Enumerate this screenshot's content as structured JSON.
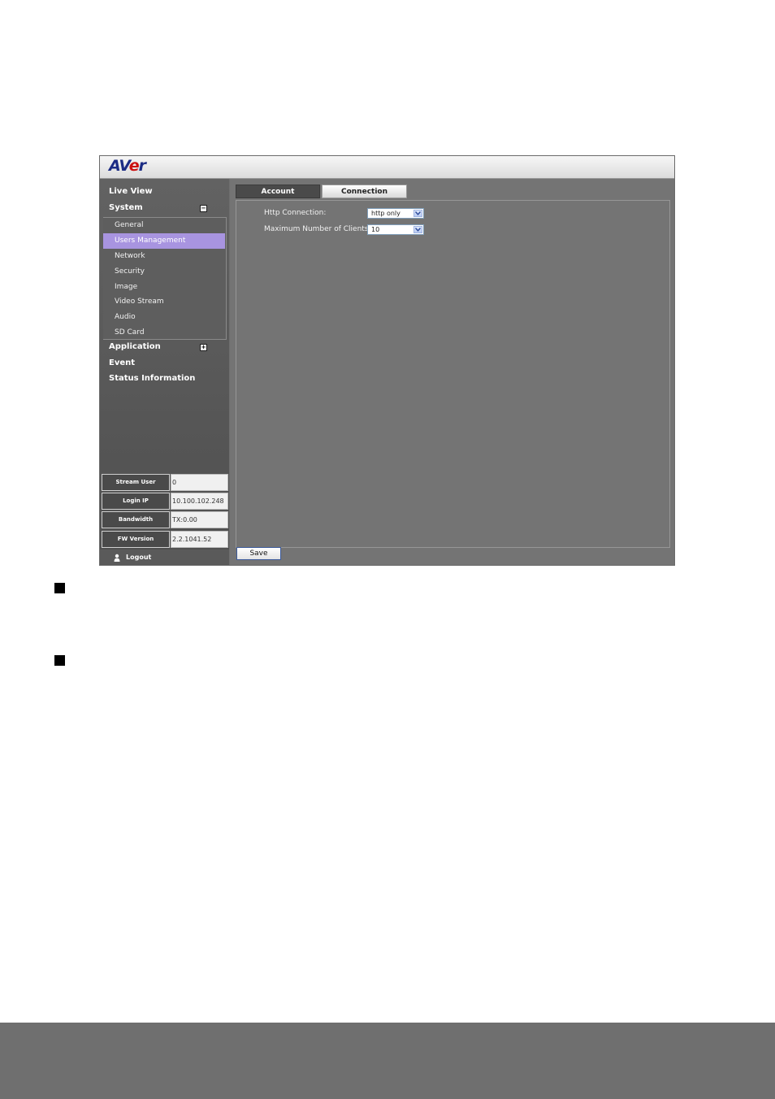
{
  "app": {
    "logo": {
      "part1": "AV",
      "part2": "e",
      "part3": "r"
    }
  },
  "sidebar": {
    "top_items": [
      {
        "label": "Live View"
      },
      {
        "label": "System",
        "toggle": "−"
      },
      {
        "label": "Application",
        "toggle": "+"
      },
      {
        "label": "Event"
      },
      {
        "label": "Status Information"
      }
    ],
    "system_items": [
      {
        "label": "General",
        "active": false
      },
      {
        "label": "Users Management",
        "active": true
      },
      {
        "label": "Network",
        "active": false
      },
      {
        "label": "Security",
        "active": false
      },
      {
        "label": "Image",
        "active": false
      },
      {
        "label": "Video Stream",
        "active": false
      },
      {
        "label": "Audio",
        "active": false
      },
      {
        "label": "SD Card",
        "active": false
      }
    ],
    "info": [
      {
        "label": "Stream User",
        "value": "0"
      },
      {
        "label": "Login IP",
        "value": "10.100.102.248"
      },
      {
        "label": "Bandwidth",
        "value": "TX:0.00"
      },
      {
        "label": "FW Version",
        "value": "2.2.1041.52"
      }
    ],
    "logout_label": "Logout",
    "logout_icon": "user-icon"
  },
  "main": {
    "tabs": [
      {
        "label": "Account",
        "selected": false
      },
      {
        "label": "Connection",
        "selected": true
      }
    ],
    "fields": [
      {
        "label": "Http Connection:",
        "value": "http only"
      },
      {
        "label": "Maximum Number of Clients:",
        "value": "10"
      }
    ],
    "save_label": "Save"
  },
  "colors": {
    "active_menu": "#a894e0",
    "logo_blue": "#1c2c84",
    "logo_red": "#cc1111",
    "footer": "#6f6f6f"
  }
}
